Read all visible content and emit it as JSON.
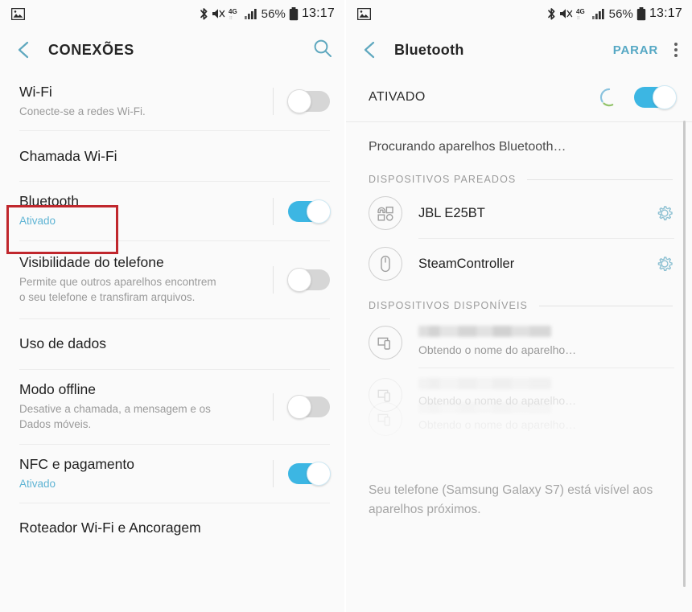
{
  "statusbar": {
    "left_icon": "image-icon",
    "icons": [
      "bluetooth-icon",
      "mute-icon",
      "network-4g-icon",
      "signal-bars-icon"
    ],
    "battery_percent": "56%",
    "battery_icon": "battery-icon",
    "clock": "13:17"
  },
  "left_screen": {
    "actionbar": {
      "back_icon": "back-chevron-icon",
      "title": "CONEXÕES",
      "search_icon": "search-icon"
    },
    "rows": [
      {
        "title": "Wi-Fi",
        "sub": "Conecte-se a redes Wi-Fi.",
        "sub_state": false,
        "toggle": "off",
        "has_toggle": true
      },
      {
        "title": "Chamada Wi-Fi",
        "sub": "",
        "sub_state": false,
        "toggle": "",
        "has_toggle": false
      },
      {
        "title": "Bluetooth",
        "sub": "Ativado",
        "sub_state": true,
        "toggle": "on",
        "has_toggle": true,
        "highlighted": true
      },
      {
        "title": "Visibilidade do telefone",
        "sub": "Permite que outros aparelhos encontrem o seu telefone e transfiram arquivos.",
        "sub_state": false,
        "toggle": "off",
        "has_toggle": true
      },
      {
        "title": "Uso de dados",
        "sub": "",
        "sub_state": false,
        "toggle": "",
        "has_toggle": false
      },
      {
        "title": "Modo offline",
        "sub": "Desative a chamada, a mensagem e os Dados móveis.",
        "sub_state": false,
        "toggle": "off",
        "has_toggle": true
      },
      {
        "title": "NFC e pagamento",
        "sub": "Ativado",
        "sub_state": true,
        "toggle": "on",
        "has_toggle": true
      },
      {
        "title": "Roteador Wi-Fi e Ancoragem",
        "sub": "",
        "sub_state": false,
        "toggle": "",
        "has_toggle": false
      }
    ]
  },
  "right_screen": {
    "actionbar": {
      "back_icon": "back-chevron-icon",
      "title": "Bluetooth",
      "action_label": "PARAR",
      "overflow_icon": "kebab-menu-icon"
    },
    "on_bar": {
      "label": "ATIVADO",
      "spinner_icon": "loading-spinner-icon",
      "toggle": "on"
    },
    "scanning_text": "Procurando aparelhos Bluetooth…",
    "paired_section": {
      "header": "DISPOSITIVOS PAREADOS",
      "devices": [
        {
          "name": "JBL E25BT",
          "icon": "headphones-device-icon",
          "settings_icon": "gear-icon"
        },
        {
          "name": "SteamController",
          "icon": "mouse-device-icon",
          "settings_icon": "gear-icon"
        }
      ]
    },
    "available_section": {
      "header": "DISPOSITIVOS DISPONÍVEIS",
      "devices": [
        {
          "name": "",
          "sub": "Obtendo o nome do aparelho…",
          "icon": "phone-device-icon",
          "redacted": true
        },
        {
          "name": "",
          "sub": "Obtendo o nome do aparelho…",
          "icon": "phone-device-icon",
          "redacted": true
        },
        {
          "name": "",
          "sub": "Obtendo o nome do aparelho…",
          "icon": "phone-device-icon",
          "redacted": true
        }
      ]
    },
    "visibility_note": "Seu telefone (Samsung Galaxy S7) está visível aos aparelhos próximos."
  },
  "colors": {
    "accent": "#3cb6e3",
    "action_text": "#56a8c4",
    "highlight_box": "#c0272d",
    "background": "#fafafa",
    "muted_text": "#9a9a9a"
  }
}
